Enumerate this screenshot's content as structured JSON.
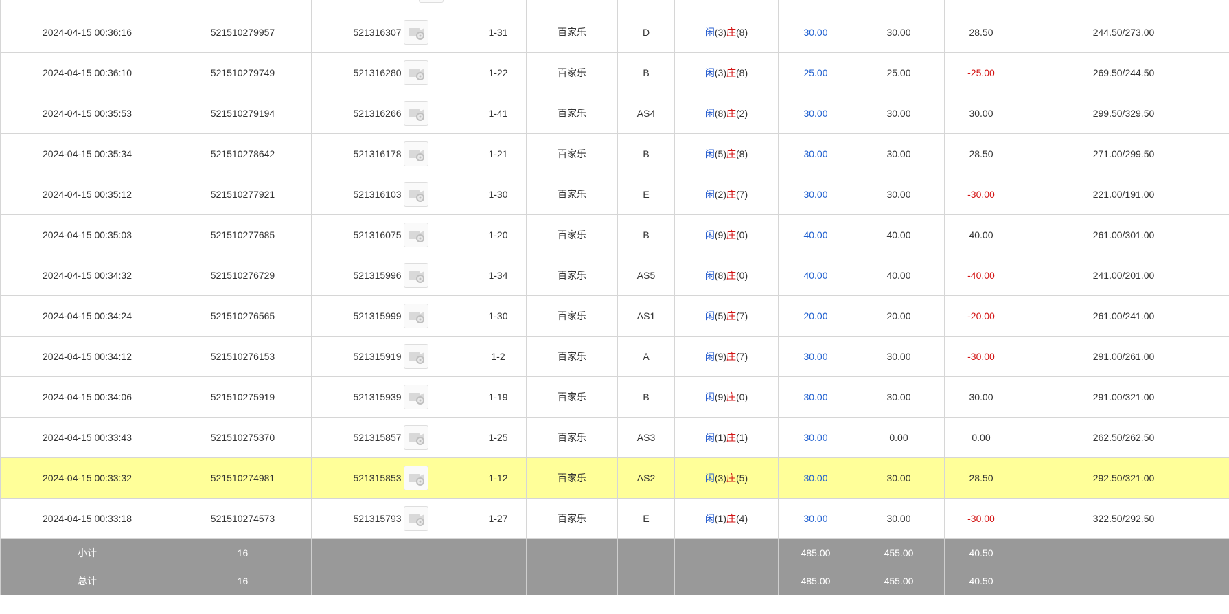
{
  "rows": [
    {
      "time": "2024-04-15 00:36:16",
      "bet_no": "521510279957",
      "round_no": "521316307",
      "table": "1-31",
      "game": "百家乐",
      "bet_type": "D",
      "result": {
        "p": "闲",
        "pv": "(3)",
        "b": "庄",
        "bv": "(8)"
      },
      "bet": "30.00",
      "valid": "30.00",
      "winloss": "28.50",
      "balance": "244.50/273.00"
    },
    {
      "time": "2024-04-15 00:36:10",
      "bet_no": "521510279749",
      "round_no": "521316280",
      "table": "1-22",
      "game": "百家乐",
      "bet_type": "B",
      "result": {
        "p": "闲",
        "pv": "(3)",
        "b": "庄",
        "bv": "(8)"
      },
      "bet": "25.00",
      "valid": "25.00",
      "winloss": "-25.00",
      "balance": "269.50/244.50"
    },
    {
      "time": "2024-04-15 00:35:53",
      "bet_no": "521510279194",
      "round_no": "521316266",
      "table": "1-41",
      "game": "百家乐",
      "bet_type": "AS4",
      "result": {
        "p": "闲",
        "pv": "(8)",
        "b": "庄",
        "bv": "(2)"
      },
      "bet": "30.00",
      "valid": "30.00",
      "winloss": "30.00",
      "balance": "299.50/329.50"
    },
    {
      "time": "2024-04-15 00:35:34",
      "bet_no": "521510278642",
      "round_no": "521316178",
      "table": "1-21",
      "game": "百家乐",
      "bet_type": "B",
      "result": {
        "p": "闲",
        "pv": "(5)",
        "b": "庄",
        "bv": "(8)"
      },
      "bet": "30.00",
      "valid": "30.00",
      "winloss": "28.50",
      "balance": "271.00/299.50"
    },
    {
      "time": "2024-04-15 00:35:12",
      "bet_no": "521510277921",
      "round_no": "521316103",
      "table": "1-30",
      "game": "百家乐",
      "bet_type": "E",
      "result": {
        "p": "闲",
        "pv": "(2)",
        "b": "庄",
        "bv": "(7)"
      },
      "bet": "30.00",
      "valid": "30.00",
      "winloss": "-30.00",
      "balance": "221.00/191.00"
    },
    {
      "time": "2024-04-15 00:35:03",
      "bet_no": "521510277685",
      "round_no": "521316075",
      "table": "1-20",
      "game": "百家乐",
      "bet_type": "B",
      "result": {
        "p": "闲",
        "pv": "(9)",
        "b": "庄",
        "bv": "(0)"
      },
      "bet": "40.00",
      "valid": "40.00",
      "winloss": "40.00",
      "balance": "261.00/301.00"
    },
    {
      "time": "2024-04-15 00:34:32",
      "bet_no": "521510276729",
      "round_no": "521315996",
      "table": "1-34",
      "game": "百家乐",
      "bet_type": "AS5",
      "result": {
        "p": "闲",
        "pv": "(8)",
        "b": "庄",
        "bv": "(0)"
      },
      "bet": "40.00",
      "valid": "40.00",
      "winloss": "-40.00",
      "balance": "241.00/201.00"
    },
    {
      "time": "2024-04-15 00:34:24",
      "bet_no": "521510276565",
      "round_no": "521315999",
      "table": "1-30",
      "game": "百家乐",
      "bet_type": "AS1",
      "result": {
        "p": "闲",
        "pv": "(5)",
        "b": "庄",
        "bv": "(7)"
      },
      "bet": "20.00",
      "valid": "20.00",
      "winloss": "-20.00",
      "balance": "261.00/241.00"
    },
    {
      "time": "2024-04-15 00:34:12",
      "bet_no": "521510276153",
      "round_no": "521315919",
      "table": "1-2",
      "game": "百家乐",
      "bet_type": "A",
      "result": {
        "p": "闲",
        "pv": "(9)",
        "b": "庄",
        "bv": "(7)"
      },
      "bet": "30.00",
      "valid": "30.00",
      "winloss": "-30.00",
      "balance": "291.00/261.00"
    },
    {
      "time": "2024-04-15 00:34:06",
      "bet_no": "521510275919",
      "round_no": "521315939",
      "table": "1-19",
      "game": "百家乐",
      "bet_type": "B",
      "result": {
        "p": "闲",
        "pv": "(9)",
        "b": "庄",
        "bv": "(0)"
      },
      "bet": "30.00",
      "valid": "30.00",
      "winloss": "30.00",
      "balance": "291.00/321.00"
    },
    {
      "time": "2024-04-15 00:33:43",
      "bet_no": "521510275370",
      "round_no": "521315857",
      "table": "1-25",
      "game": "百家乐",
      "bet_type": "AS3",
      "result": {
        "p": "闲",
        "pv": "(1)",
        "b": "庄",
        "bv": "(1)"
      },
      "bet": "30.00",
      "valid": "0.00",
      "winloss": "0.00",
      "balance": "262.50/262.50"
    },
    {
      "time": "2024-04-15 00:33:32",
      "bet_no": "521510274981",
      "round_no": "521315853",
      "table": "1-12",
      "game": "百家乐",
      "bet_type": "AS2",
      "result": {
        "p": "闲",
        "pv": "(3)",
        "b": "庄",
        "bv": "(5)"
      },
      "bet": "30.00",
      "valid": "30.00",
      "winloss": "28.50",
      "balance": "292.50/321.00",
      "highlight": true
    },
    {
      "time": "2024-04-15 00:33:18",
      "bet_no": "521510274573",
      "round_no": "521315793",
      "table": "1-27",
      "game": "百家乐",
      "bet_type": "E",
      "result": {
        "p": "闲",
        "pv": "(1)",
        "b": "庄",
        "bv": "(4)"
      },
      "bet": "30.00",
      "valid": "30.00",
      "winloss": "-30.00",
      "balance": "322.50/292.50"
    }
  ],
  "subtotal": {
    "label": "小计",
    "count": "16",
    "bet": "485.00",
    "valid": "455.00",
    "winloss": "40.50"
  },
  "total": {
    "label": "总计",
    "count": "16",
    "bet": "485.00",
    "valid": "455.00",
    "winloss": "40.50"
  },
  "icons": {
    "video": "video-replay-icon"
  },
  "colors": {
    "highlight_row": "#ffff99",
    "summary_bg": "#999999",
    "positive": "#1f5fcf",
    "negative": "#d31414"
  }
}
